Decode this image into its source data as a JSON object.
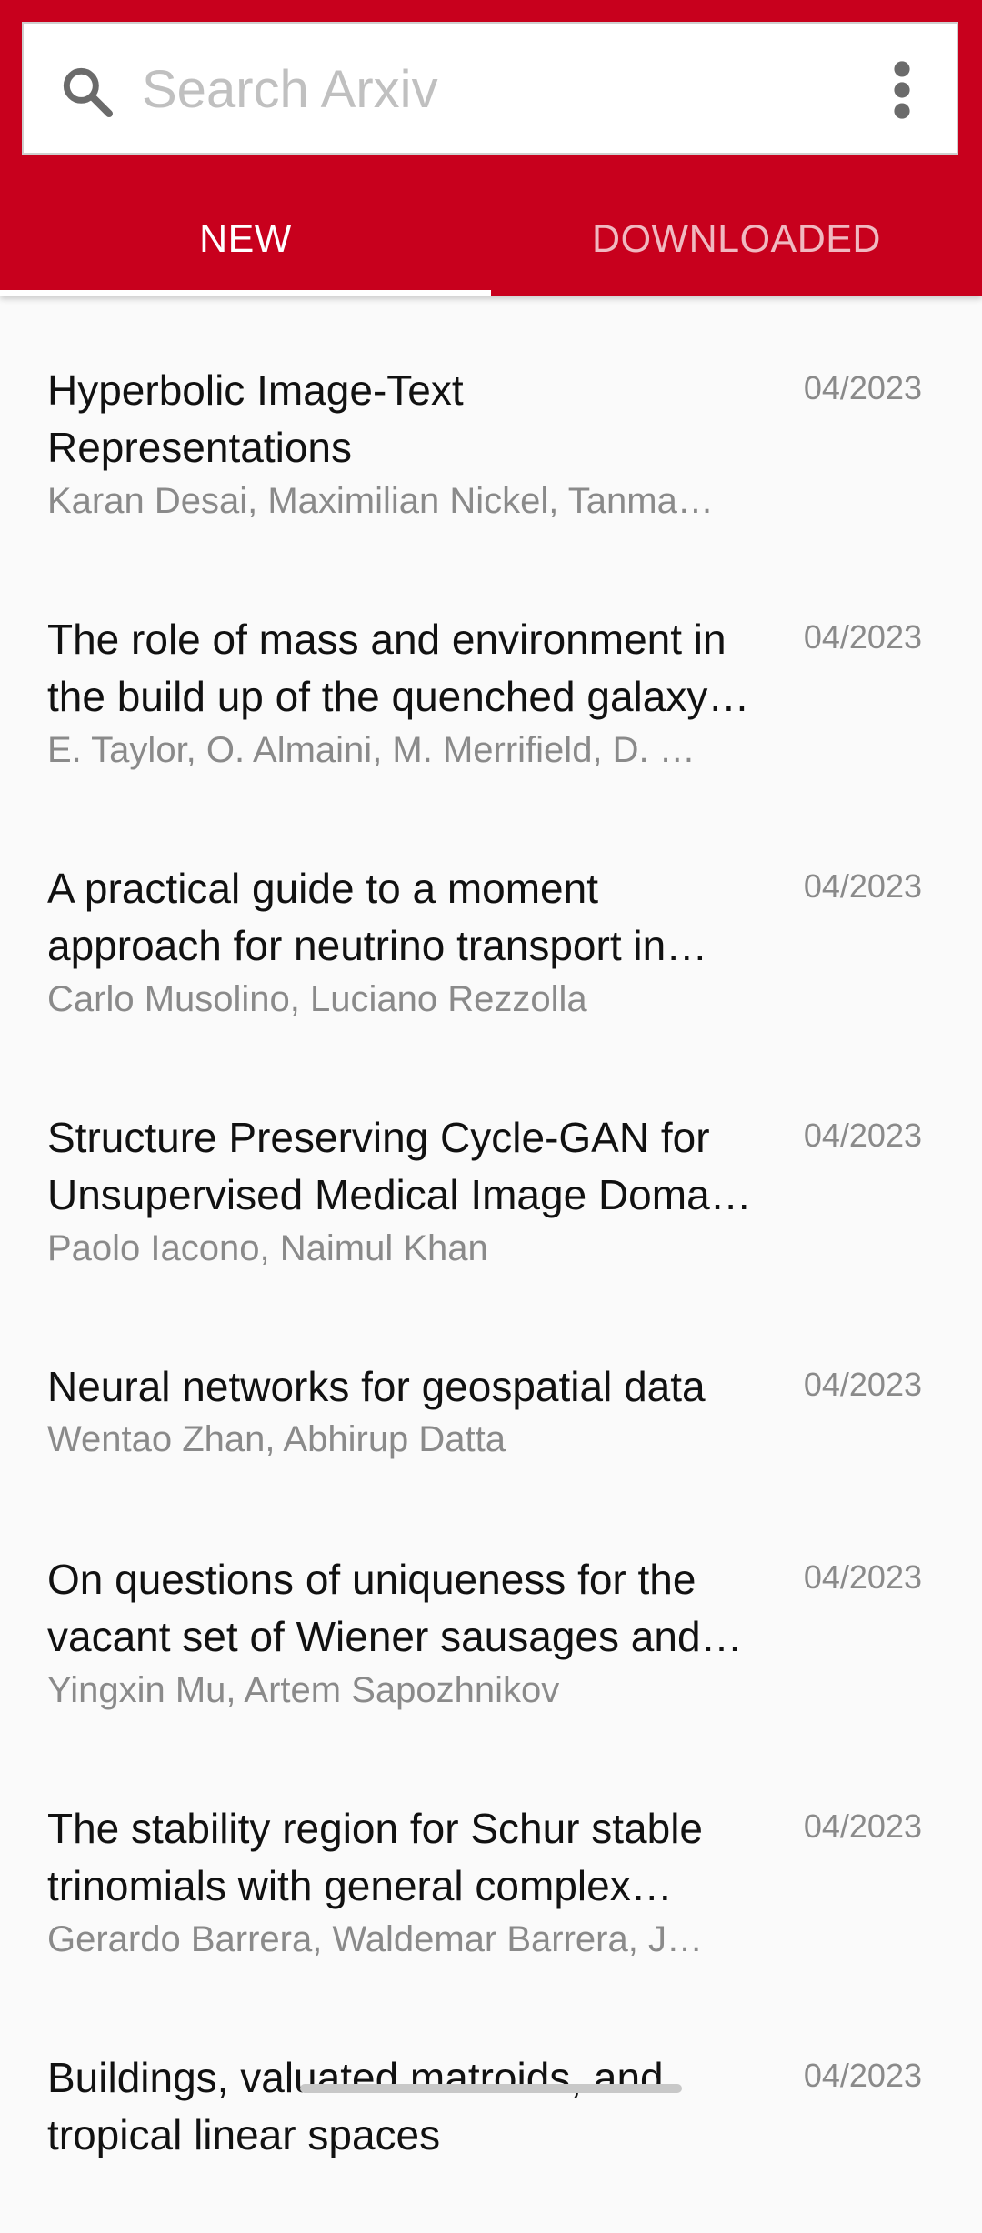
{
  "search": {
    "placeholder": "Search Arxiv",
    "value": ""
  },
  "tabs": [
    {
      "label": "NEW",
      "active": true
    },
    {
      "label": "DOWNLOADED",
      "active": false
    }
  ],
  "colors": {
    "brand": "#c8001d",
    "background": "#fafafa",
    "title": "#111111",
    "secondary": "#8a8a8a"
  },
  "papers": [
    {
      "title": "Hyperbolic Image-Text Representations",
      "authors": "Karan Desai, Maximilian Nickel, Tanmay Rajpurohit, Justin Johnson, Ramakrishna Vedantam",
      "date": "04/2023"
    },
    {
      "title": "The role of mass and environment in the build up of the quenched galaxy population",
      "authors": "E. Taylor, O. Almaini, M. Merrifield, D. Maltby",
      "date": "04/2023"
    },
    {
      "title": "A practical guide to a moment approach for neutrino transport in numerical relativity",
      "authors": "Carlo Musolino, Luciano Rezzolla",
      "date": "04/2023"
    },
    {
      "title": "Structure Preserving Cycle-GAN for Unsupervised Medical Image Domain Adaptation",
      "authors": "Paolo Iacono, Naimul Khan",
      "date": "04/2023"
    },
    {
      "title": "Neural networks for geospatial data",
      "authors": "Wentao Zhan, Abhirup Datta",
      "date": "04/2023"
    },
    {
      "title": "On questions of uniqueness for the vacant set of Wiener sausages and Brownian interlacements",
      "authors": "Yingxin Mu, Artem Sapozhnikov",
      "date": "04/2023"
    },
    {
      "title": "The stability region for Schur stable trinomials with general complex coefficients",
      "authors": "Gerardo Barrera, Waldemar Barrera, Juan Pablo Navarrete",
      "date": "04/2023"
    },
    {
      "title": "Buildings, valuated matroids, and tropical linear spaces",
      "authors": "",
      "date": "04/2023"
    }
  ]
}
